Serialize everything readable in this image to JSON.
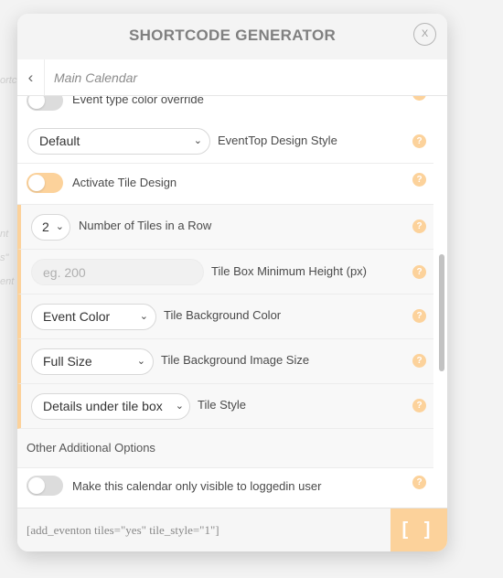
{
  "modal": {
    "title": "SHORTCODE GENERATOR",
    "close_label": "X",
    "breadcrumb": "Main Calendar"
  },
  "rows": {
    "event_type_color": {
      "label": "Event type color override",
      "toggle": "off"
    },
    "eventtop_style": {
      "value": "Default",
      "label": "EventTop Design Style"
    },
    "tile_design": {
      "label": "Activate Tile Design",
      "toggle": "on"
    },
    "tiles_in_row": {
      "value": "2",
      "label": "Number of Tiles in a Row"
    },
    "tile_min_height": {
      "placeholder": "eg. 200",
      "value": "",
      "label": "Tile Box Minimum Height (px)"
    },
    "tile_bg_color": {
      "value": "Event Color",
      "label": "Tile Background Color"
    },
    "tile_bg_image": {
      "value": "Full Size",
      "label": "Tile Background Image Size"
    },
    "tile_style": {
      "value": "Details under tile box",
      "label": "Tile Style"
    },
    "other_options": {
      "label": "Other Additional Options"
    },
    "loggedin_only": {
      "label": "Make this calendar only visible to loggedin user",
      "toggle": "off"
    }
  },
  "help_glyph": "?",
  "footer": {
    "shortcode": "[add_eventon tiles=\"yes\" tile_style=\"1\"]",
    "insert_label": "[ ]"
  },
  "colors": {
    "accent": "#fcd29b",
    "toggle_off": "#dcdcdc"
  }
}
